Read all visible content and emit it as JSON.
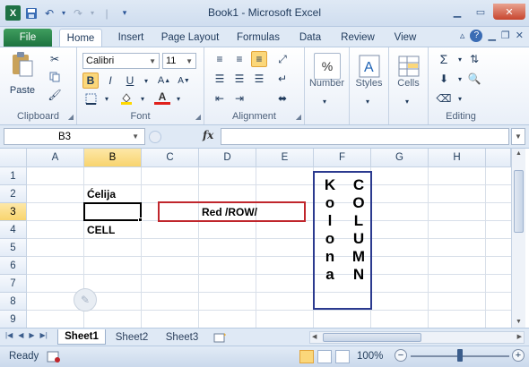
{
  "window": {
    "title": "Book1 - Microsoft Excel",
    "app_icon": "X"
  },
  "ribbon_tabs": [
    "File",
    "Home",
    "Insert",
    "Page Layout",
    "Formulas",
    "Data",
    "Review",
    "View"
  ],
  "active_tab": "Home",
  "ribbon": {
    "clipboard": {
      "label": "Clipboard",
      "paste": "Paste"
    },
    "font": {
      "label": "Font",
      "font_name": "Calibri",
      "font_size": "11",
      "bold": "B",
      "italic": "I",
      "underline": "U"
    },
    "alignment": {
      "label": "Alignment"
    },
    "number": {
      "label": "Number",
      "icon_text": "%"
    },
    "styles": {
      "label": "Styles"
    },
    "cells": {
      "label": "Cells"
    },
    "editing": {
      "label": "Editing",
      "sum": "Σ"
    }
  },
  "formula_bar": {
    "name_box": "B3",
    "fx": "fx",
    "formula": ""
  },
  "grid": {
    "columns": [
      "A",
      "B",
      "C",
      "D",
      "E",
      "F",
      "G",
      "H"
    ],
    "rows": [
      "1",
      "2",
      "3",
      "4",
      "5",
      "6",
      "7",
      "8",
      "9"
    ],
    "selected_column": "B",
    "selected_row": "3",
    "cells": {
      "B2": "Ćelija",
      "B4": "CELL",
      "D3": "Red /ROW/",
      "F_left_vertical": [
        "K",
        "o",
        "l",
        "o",
        "n",
        "a"
      ],
      "F_right_vertical": [
        "C",
        "O",
        "L",
        "U",
        "M",
        "N"
      ]
    },
    "colors": {
      "row_highlight_border": "#c0262c",
      "column_highlight_border": "#2b3a8f",
      "selected_cell_border": "#000000"
    }
  },
  "sheets": [
    "Sheet1",
    "Sheet2",
    "Sheet3"
  ],
  "active_sheet": "Sheet1",
  "status": {
    "mode": "Ready",
    "zoom": "100%"
  }
}
